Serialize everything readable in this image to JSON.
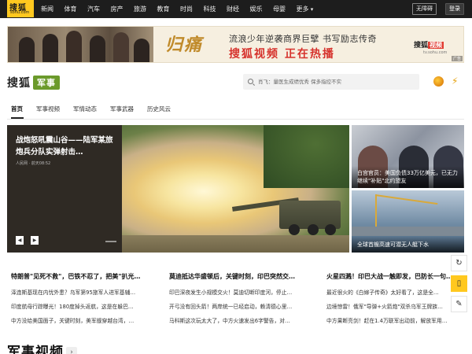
{
  "topnav": {
    "logo": {
      "name": "搜狐",
      "url": "sohu.com"
    },
    "items": [
      "新闻",
      "体育",
      "汽车",
      "房产",
      "旅游",
      "教育",
      "时尚",
      "科技",
      "财经",
      "娱乐",
      "母婴",
      "更多"
    ],
    "barrier_free": "无障碍",
    "login": "登录"
  },
  "banner": {
    "title_art": "归痛",
    "line1": "流浪少年逆袭商界巨擘  书写励志传奇",
    "line2": "搜狐视频  正在热播",
    "brand": "搜狐",
    "brand_tag": "视频",
    "brand_url": "tv.sohu.com",
    "ad_label": "广告"
  },
  "header": {
    "logo": "搜狐",
    "channel": "军事",
    "search_placeholder": "肖飞：量医生成绩优秀 保多指控不实"
  },
  "subnav": [
    "首页",
    "军事视频",
    "军情动态",
    "军事武器",
    "历史风云"
  ],
  "hero": {
    "left_title": "战炮怒吼震山谷——陆军某旅炮兵分队实弹射击…",
    "left_meta": "人民网 · 前天08:52",
    "right1_title": "白宫官员：美国负债33万亿美元，已无力继续\"补贴\"北约盟友",
    "right2_title": "全球首艘高速可潜无人艇下水"
  },
  "news": [
    {
      "head": "特朗普\"见死不救\"，巴铁不忍了，把美\"扒光…",
      "items": [
        "泽连斯基现在内忧外患？乌军第95旅军人进军基辅…",
        "印度航母行踪曝光！180度掉头返航，这是在躲巴…",
        "中方没给美国面子，关键时刻，美军舰穿越台湾，…"
      ]
    },
    {
      "head": "莫迪抵达华盛顿后，关键时刻，印巴突然交…",
      "items": [
        "印巴深夜发生小规模交火！莫迪切断印度河，停止…",
        "开弓没有回头箭！两岸统一已经启动，赖清德心里…",
        "马科斯这次玩太大了，中方火速发出6字警告，对…"
      ]
    },
    {
      "head": "火星四溅！印巴大战一触即发，巴防长一句…",
      "items": [
        "最近很火的《白嫁子传奇》太好看了，这是全…",
        "边境惊雷！俄军\"导弹+火箭炮\"双杀乌军王牌族…",
        "中方果断亮剑！赶在1.4万联军出动前，解放军用…"
      ]
    }
  ],
  "section": {
    "title": "军事视频",
    "arrow": "›"
  },
  "tools": [
    "refresh-icon",
    "app-icon",
    "edit-icon"
  ]
}
